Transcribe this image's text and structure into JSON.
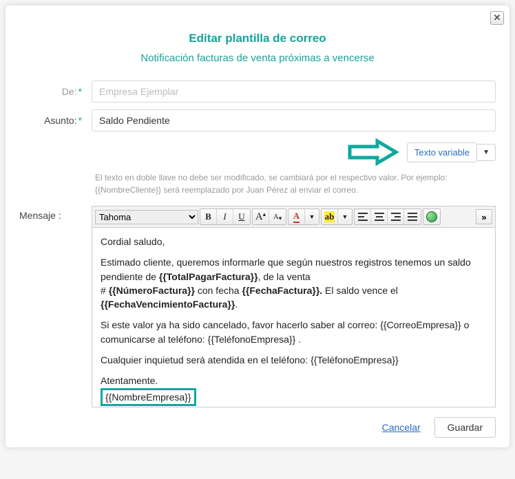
{
  "modal": {
    "title": "Editar plantilla de correo",
    "subtitle": "Notificación facturas de venta próximas a vencerse"
  },
  "form": {
    "from_label": "De:",
    "from_value": "Empresa Ejemplar",
    "subject_label": "Asunto:",
    "subject_value": "Saldo Pendiente"
  },
  "variable_button": "Texto variable",
  "hint_line1": "El texto en doble llave no debe ser modificado, se cambiará por el respectivo valor. Por ejemplo:",
  "hint_line2": "{{NombreCliente}} será reemplazado por Juan Pérez al enviar el correo.",
  "message_label": "Mensaje :",
  "toolbar": {
    "font": "Tahoma"
  },
  "body": {
    "greeting": "Cordial saludo,",
    "p1a": "Estimado cliente, queremos informarle que según nuestros registros tenemos un saldo pendiente de ",
    "totalPagar": "{{TotalPagarFactura}}",
    "p1b": ", de la venta",
    "p2a": "# ",
    "numFactura": "{{NúmeroFactura}}",
    "p2b": " con fecha ",
    "fechaFactura": "{{FechaFactura}}.",
    "p2c": "  El saldo vence el ",
    "fechaVenc": "{{FechaVencimientoFactura}}",
    "p3a": "Si este valor ya ha sido cancelado, favor hacerlo saber al correo: ",
    "correoEmp": "{{CorreoEmpresa}}",
    "p3b": " o comunicarse al teléfono: ",
    "telEmp": "{{TeléfonoEmpresa}}",
    "p3c": " .",
    "p4a": "Cualquier inquietud será atendida en el teléfono: ",
    "telEmp2": "{{TeléfonoEmpresa}}",
    "signoff": "Atentamente.",
    "nombreEmp": "{{NombreEmpresa}}"
  },
  "footer": {
    "cancel": "Cancelar",
    "save": "Guardar"
  }
}
